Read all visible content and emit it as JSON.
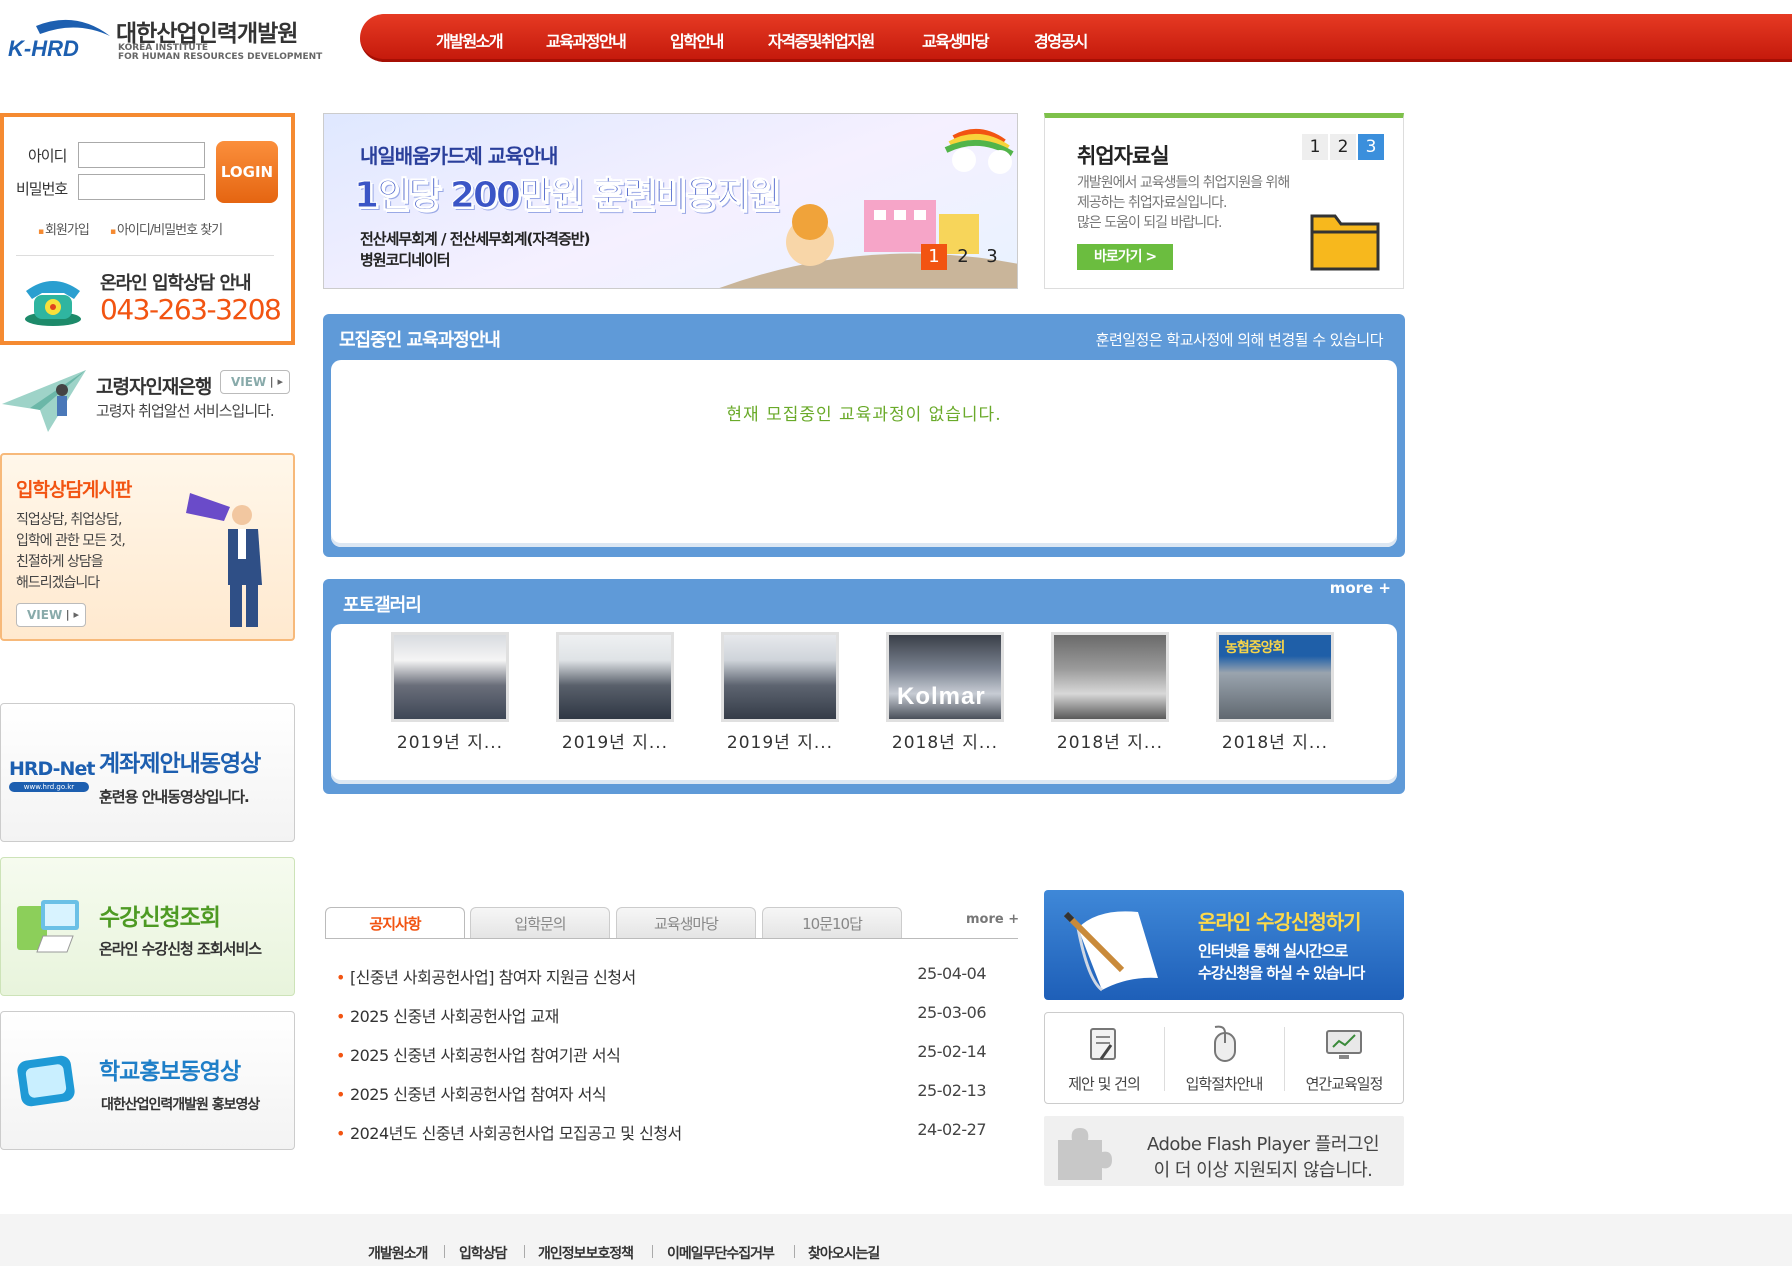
{
  "header": {
    "logo_text": "K-HRD",
    "site_name": "대한산업인력개발원",
    "site_name_en_1": "KOREA INSTITUTE",
    "site_name_en_2": "FOR HUMAN RESOURCES DEVELOPMENT",
    "nav": [
      "개발원소개",
      "교육과정안내",
      "입학안내",
      "자격증및취업지원",
      "교육생마당",
      "경영공시"
    ]
  },
  "login": {
    "id_label": "아이디",
    "pw_label": "비밀번호",
    "id_value": "",
    "pw_value": "",
    "login_button": "LOGIN",
    "join_link": "회원가입",
    "find_link": "아이디/비밀번호 찾기",
    "consult_title": "온라인 입학상담 안내",
    "consult_phone": "043-263-3208"
  },
  "side": {
    "elder_title": "고령자인재은행",
    "elder_desc": "고령자 취업알선 서비스입니다.",
    "view_label": "VIEW",
    "board_title": "입학상담게시판",
    "board_desc_1": "직업상담, 취업상담,",
    "board_desc_2": "입학에 관한 모든 것,",
    "board_desc_3": "친절하게 상담을",
    "board_desc_4": "해드리겠습니다",
    "hrd_logo": "HRD-Net",
    "hrd_logo_sub": "www.hrd.go.kr",
    "hrd_title": "계좌제안내동영상",
    "hrd_desc": "훈련용 안내동영상입니다.",
    "course_title": "수강신청조회",
    "course_desc": "온라인 수강신청 조회서비스",
    "promo_title": "학교홍보동영상",
    "promo_desc": "대한산업인력개발원 홍보영상"
  },
  "banner": {
    "line1": "내일배움카드제 교육안내",
    "line2": "1인당 200만원 훈련비용지원",
    "line3": "전산세무회계 / 전산세무회계(자격증반)",
    "line4": "병원코디네이터",
    "pages": [
      "1",
      "2",
      "3"
    ],
    "active_page": 1
  },
  "job": {
    "title": "취업자료실",
    "desc_1": "개발원에서 교육생들의 취업지원을 위해",
    "desc_2": "제공하는 취업자료실입니다.",
    "desc_3": "많은 도움이 되길 바랍니다.",
    "button": "바로가기 >",
    "pages": [
      "1",
      "2",
      "3"
    ],
    "active_page": 3
  },
  "recruit": {
    "title": "모집중인 교육과정안내",
    "note": "훈련일정은 학교사정에 의해 변경될 수 있습니다",
    "empty_message": "현재 모집중인 교육과정이 없습니다."
  },
  "gallery": {
    "title": "포토갤러리",
    "more": "more +",
    "items": [
      {
        "caption": "2019년 지..."
      },
      {
        "caption": "2019년 지..."
      },
      {
        "caption": "2019년 지..."
      },
      {
        "caption": "2018년 지..."
      },
      {
        "caption": "2018년 지..."
      },
      {
        "caption": "2018년 지..."
      }
    ],
    "sign_text_4": "Kolmar",
    "sign_text_6": "농협중앙회"
  },
  "notice": {
    "tabs": [
      "공지사항",
      "입학문의",
      "교육생마당",
      "10문10답"
    ],
    "active_tab": 0,
    "more": "more +",
    "rows": [
      {
        "title": "[신중년 사회공헌사업] 참여자 지원금 신청서",
        "date": "25-04-04"
      },
      {
        "title": "2025 신중년 사회공헌사업 교재",
        "date": "25-03-06"
      },
      {
        "title": "2025 신중년 사회공헌사업 참여기관 서식",
        "date": "25-02-14"
      },
      {
        "title": "2025 신중년 사회공헌사업 참여자 서식",
        "date": "25-02-13"
      },
      {
        "title": "2024년도 신중년 사회공헌사업 모집공고 및 신청서",
        "date": "24-02-27"
      }
    ]
  },
  "apply": {
    "title": "온라인 수강신청하기",
    "desc_1": "인터넷을 통해 실시간으로",
    "desc_2": "수강신청을 하실 수 있습니다"
  },
  "quick_links": [
    "제안 및 건의",
    "입학절차안내",
    "연간교육일정"
  ],
  "flash": {
    "line1": "Adobe Flash Player 플러그인",
    "line2": "이 더 이상 지원되지 않습니다."
  },
  "footer": {
    "links": [
      "개발원소개",
      "입학상담",
      "개인정보보호정책",
      "이메일무단수집거부",
      "찾아오시는길"
    ]
  },
  "colors": {
    "brand_red": "#d9281a",
    "accent_orange": "#f25412",
    "panel_blue": "#5f9ad8",
    "green": "#7ec14a"
  }
}
